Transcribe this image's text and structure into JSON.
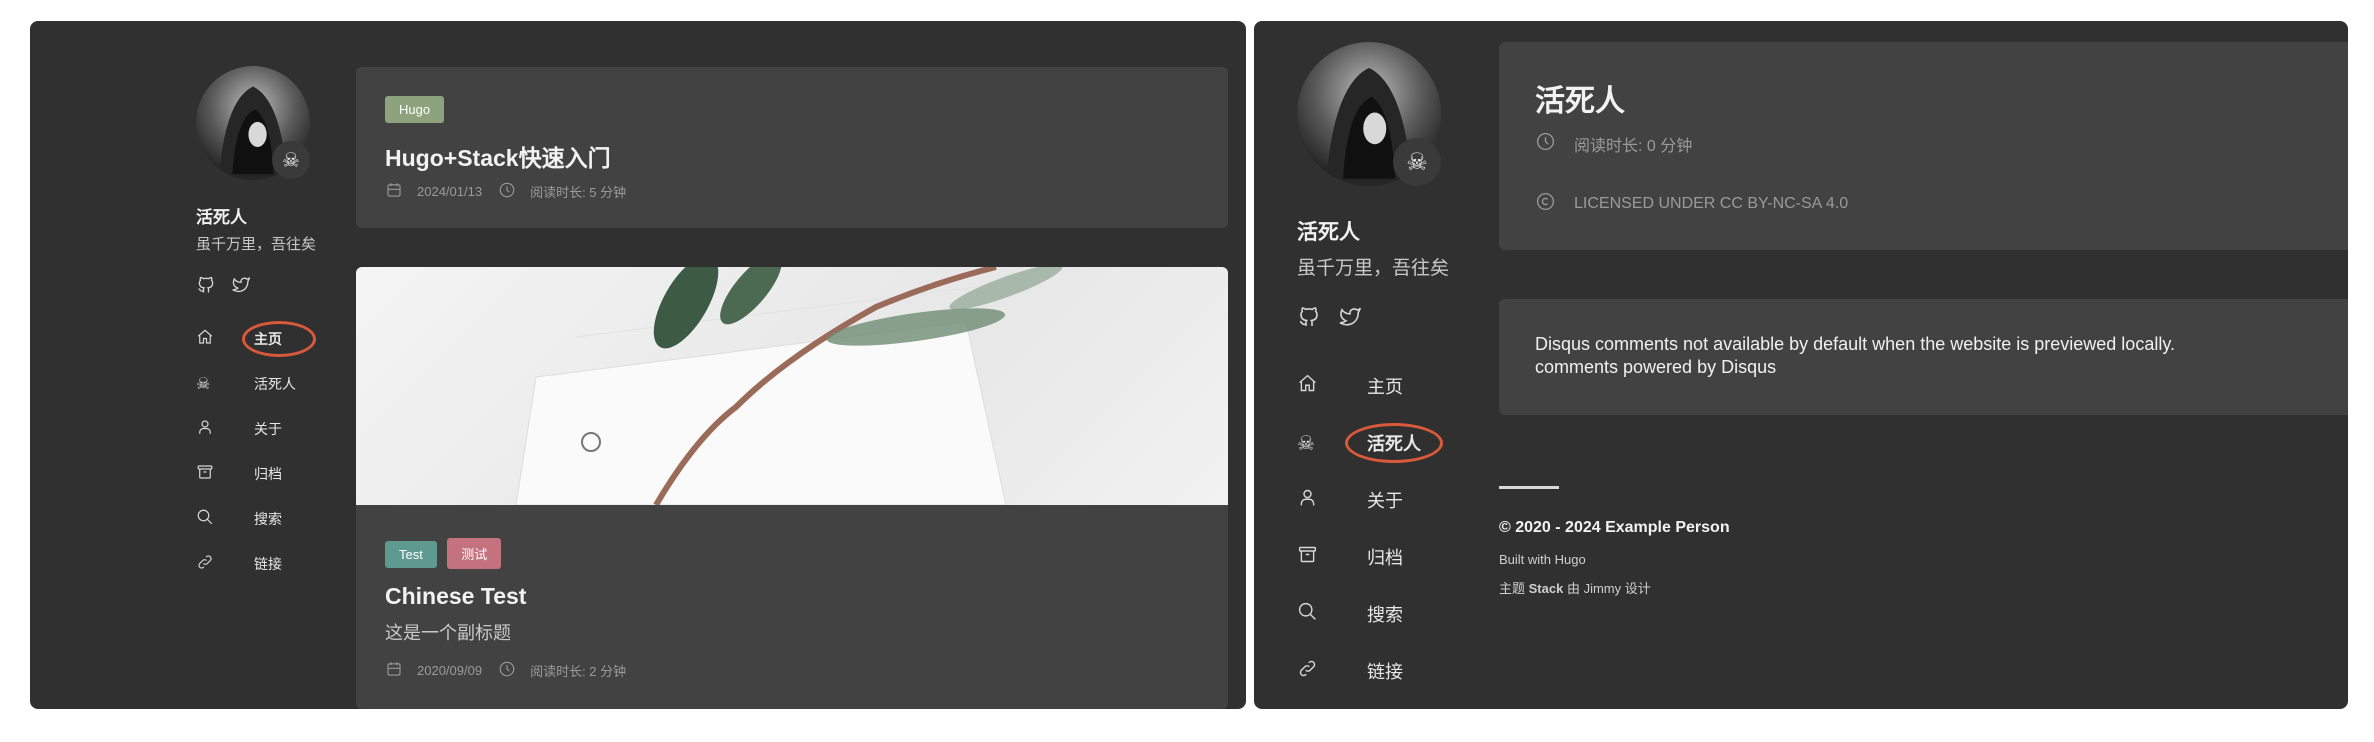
{
  "left": {
    "sidebar": {
      "site_name": "活死人",
      "site_description": "虽千万里，吾往矣",
      "menu": [
        {
          "label": "主页",
          "icon": "home-icon",
          "active": true
        },
        {
          "label": "活死人",
          "icon": "skull-icon"
        },
        {
          "label": "关于",
          "icon": "user-icon"
        },
        {
          "label": "归档",
          "icon": "archive-icon"
        },
        {
          "label": "搜索",
          "icon": "search-icon"
        },
        {
          "label": "链接",
          "icon": "link-icon"
        }
      ]
    },
    "articles": [
      {
        "tags": [
          {
            "label": "Hugo",
            "color": "#8da37e"
          }
        ],
        "title": "Hugo+Stack快速入门",
        "date": "2024/01/13",
        "reading_time": "阅读时长: 5 分钟"
      },
      {
        "tags": [
          {
            "label": "Test",
            "color": "#5f9a90"
          },
          {
            "label": "测试",
            "color": "#c4727e"
          }
        ],
        "title": "Chinese Test",
        "subtitle": "这是一个副标题",
        "date": "2020/09/09",
        "reading_time": "阅读时长: 2 分钟"
      }
    ]
  },
  "right": {
    "sidebar": {
      "site_name": "活死人",
      "site_description": "虽千万里，吾往矣",
      "menu": [
        {
          "label": "主页",
          "icon": "home-icon"
        },
        {
          "label": "活死人",
          "icon": "skull-icon",
          "active": true
        },
        {
          "label": "关于",
          "icon": "user-icon"
        },
        {
          "label": "归档",
          "icon": "archive-icon"
        },
        {
          "label": "搜索",
          "icon": "search-icon"
        },
        {
          "label": "链接",
          "icon": "link-icon"
        }
      ]
    },
    "article": {
      "title": "活死人",
      "reading_time": "阅读时长: 0 分钟",
      "license": "LICENSED UNDER CC BY-NC-SA 4.0"
    },
    "comments": {
      "line1": "Disqus comments not available by default when the website is previewed locally.",
      "line2": "comments powered by Disqus"
    },
    "footer": {
      "copyright": "© 2020 - 2024 Example Person",
      "built_with": "Built with Hugo",
      "theme_prefix": "主题",
      "theme_name": "Stack",
      "theme_by": "由 Jimmy 设计"
    }
  },
  "colors": {
    "panel_bg": "#303030",
    "card_bg": "#424242",
    "highlight_circle": "#d9593b"
  }
}
